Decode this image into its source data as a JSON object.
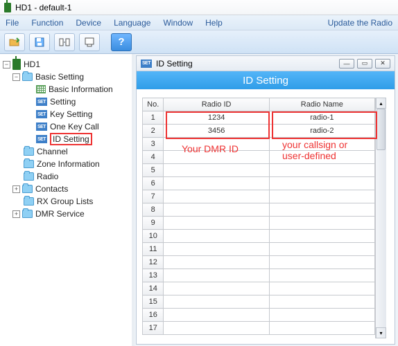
{
  "title": "HD1  -  default-1",
  "menu": {
    "file": "File",
    "function": "Function",
    "device": "Device",
    "language": "Language",
    "window": "Window",
    "help": "Help",
    "right": "Update the Radio"
  },
  "tree": {
    "root": "HD1",
    "basic": {
      "label": "Basic Setting",
      "items": [
        "Basic Information",
        "Setting",
        "Key Setting",
        "One Key Call",
        "ID Setting"
      ]
    },
    "channel": "Channel",
    "zone": "Zone Information",
    "radio": "Radio",
    "contacts": "Contacts",
    "rx": "RX Group Lists",
    "dmr": "DMR Service"
  },
  "child": {
    "title": "ID Setting",
    "banner": "ID Setting",
    "columns": {
      "no": "No.",
      "rid": "Radio ID",
      "rname": "Radio Name"
    },
    "rows": [
      {
        "no": "1",
        "rid": "1234",
        "rname": "radio-1"
      },
      {
        "no": "2",
        "rid": "3456",
        "rname": "radio-2"
      },
      {
        "no": "3"
      },
      {
        "no": "4"
      },
      {
        "no": "5"
      },
      {
        "no": "6"
      },
      {
        "no": "7"
      },
      {
        "no": "8"
      },
      {
        "no": "9"
      },
      {
        "no": "10"
      },
      {
        "no": "11"
      },
      {
        "no": "12"
      },
      {
        "no": "13"
      },
      {
        "no": "14"
      },
      {
        "no": "15"
      },
      {
        "no": "16"
      },
      {
        "no": "17"
      }
    ]
  },
  "annotations": {
    "dmr": "Your DMR ID",
    "callsign": "your callsign or\nuser-defined"
  }
}
